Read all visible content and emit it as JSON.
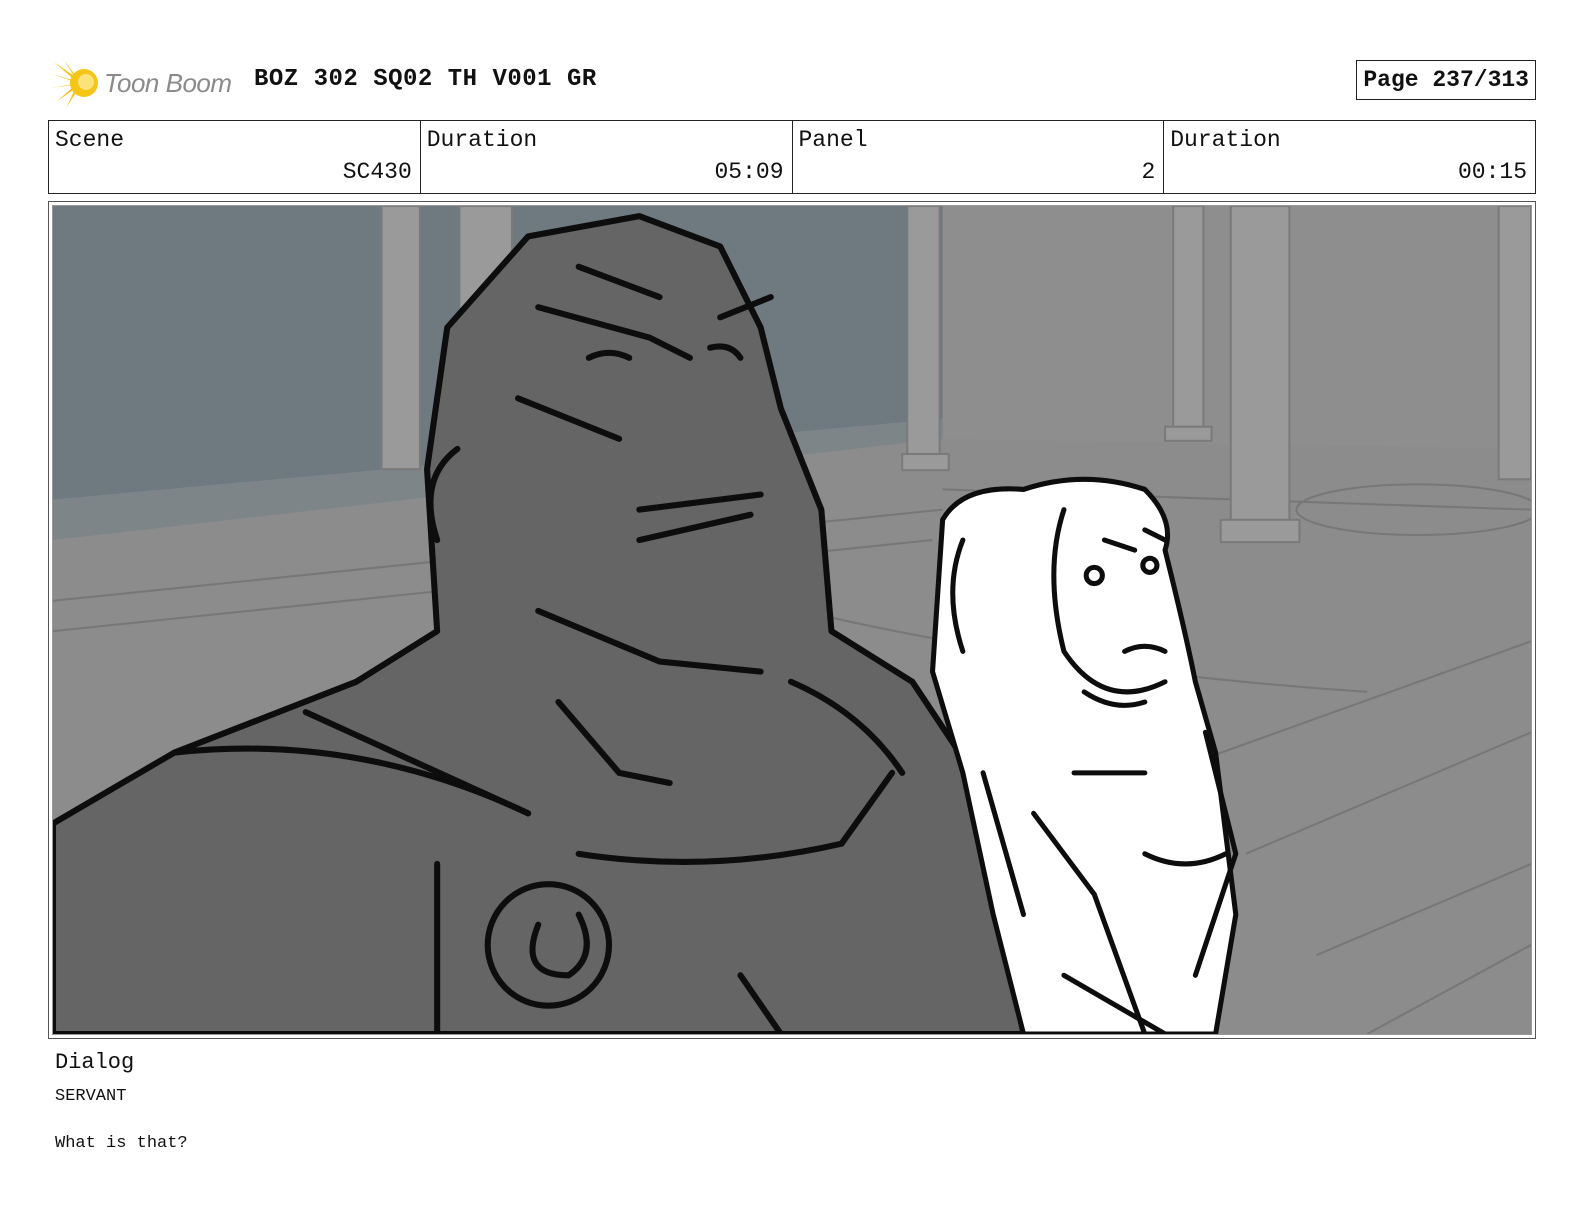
{
  "header": {
    "logo_text": "Toon Boom",
    "title": "BOZ 302 SQ02 TH V001 GR",
    "page": "Page 237/313"
  },
  "info": {
    "scene": {
      "label": "Scene",
      "value": "SC430"
    },
    "scene_duration": {
      "label": "Duration",
      "value": "05:09"
    },
    "panel": {
      "label": "Panel",
      "value": "2"
    },
    "panel_duration": {
      "label": "Duration",
      "value": "00:15"
    }
  },
  "dialog": {
    "heading": "Dialog",
    "speaker": "SERVANT",
    "line": "What is that?"
  },
  "colors": {
    "logo_accent": "#f5c518",
    "background_wall": "#6f7a80",
    "floor": "#8e8e8e",
    "character_fill": "#656565",
    "ink": "#0d0d0d"
  }
}
